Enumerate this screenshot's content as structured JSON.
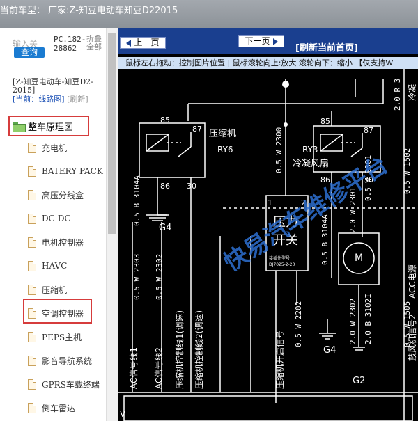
{
  "window": {
    "title": "当前车型：  厂家:Z-知豆电动车知豆D22015"
  },
  "left": {
    "search_placeholder": "输入关",
    "query_button": "查询",
    "pc_code": "PC.182-28862",
    "collapse_all": "折叠全部",
    "model": "[Z-知豆电动车-知豆D2-2015]",
    "current_prefix": "[当前：线路图]",
    "refresh_link": "[刷新]",
    "root": "整车原理图",
    "items": [
      "充电机",
      "BATERY PACK",
      "高压分线盒",
      "DC-DC",
      "电机控制器",
      "HAVC",
      "压缩机",
      "空调控制器",
      "PEPS主机",
      "影音导航系统",
      "GPRS车载终端",
      "倒车雷达"
    ]
  },
  "viewer": {
    "prev_button": "上一页",
    "next_button": "下一页",
    "refresh_home": "[刷新当前首页]",
    "help": "鼠标左右拖动：控制图片位置 | 鼠标滚轮向上:放大  滚轮向下：缩小 【仅支持W",
    "watermark": "快易汽车维修平台",
    "diagram_labels": {
      "compressor": "压缩机",
      "ry6": "RY6",
      "fan": "冷凝风扇",
      "ry3": "RY3",
      "switch1": "压力",
      "switch2": "开关",
      "part_small1": "接插件型号：",
      "part_small2": "DJ7025-2-20",
      "g4a": "G4",
      "g4b": "G4",
      "g2": "G2",
      "m": "M",
      "n85a": "85",
      "n86a": "86",
      "n87a": "87",
      "n30a": "30",
      "n85b": "85",
      "n86b": "86",
      "n87b": "87",
      "n30b": "30",
      "n1": "1",
      "n2": "2",
      "w1": "0.5 B 3104A",
      "w2": "0.5 W 2303",
      "w3": "0.5 W 2302",
      "w4": "0.5 W 2300",
      "w5": "0.5 W 2301",
      "w6": "0.5 W 2202",
      "w7": "0.5 B 3104A",
      "w8": "2.0 W 2301",
      "w9": "2.0 B 3102I",
      "w10": "2.0 W 2302",
      "w11": "2.0 R 3",
      "w12": "0.5 W 1502",
      "w13": "0.5 W 1505",
      "s1": "AC信号线1",
      "s2": "AC信号线2",
      "s3": "压缩机控制线1(调速)",
      "s4": "压缩机控制线2(调速)",
      "s5": "压缩机开启信号",
      "s6": "ACC电源",
      "s7": "鼓风机信号2",
      "s8": "冷凝",
      "v": "V"
    }
  },
  "colors": {
    "accent_blue": "#1a3f8f",
    "highlight_red": "#d63c3c",
    "watermark": "#2d6fd1"
  }
}
